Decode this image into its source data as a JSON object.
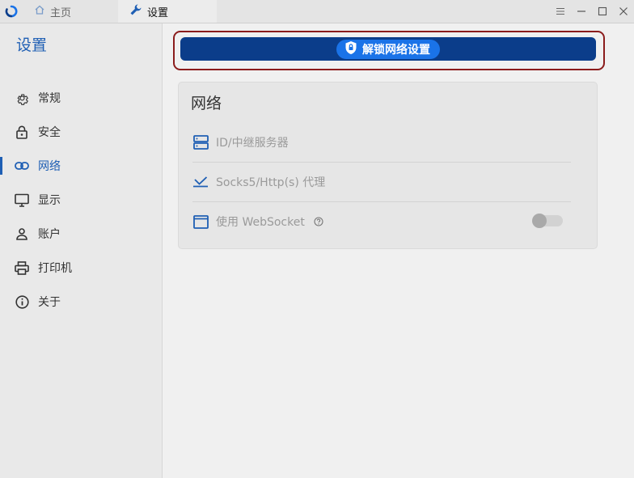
{
  "titlebar": {
    "tabs": [
      {
        "label": "主页",
        "icon": "home-icon"
      },
      {
        "label": "设置",
        "icon": "wrench-icon"
      }
    ],
    "controls": [
      "menu-icon",
      "minimize-icon",
      "maximize-icon",
      "close-icon"
    ]
  },
  "sidebar": {
    "title": "设置",
    "items": [
      {
        "label": "常规",
        "icon": "gear-icon"
      },
      {
        "label": "安全",
        "icon": "lock-icon"
      },
      {
        "label": "网络",
        "icon": "link-icon",
        "active": true
      },
      {
        "label": "显示",
        "icon": "monitor-icon"
      },
      {
        "label": "账户",
        "icon": "user-icon"
      },
      {
        "label": "打印机",
        "icon": "printer-icon"
      },
      {
        "label": "关于",
        "icon": "info-icon"
      }
    ]
  },
  "main": {
    "unlock_label": "解锁网络设置",
    "card": {
      "title": "网络",
      "rows": [
        {
          "label": "ID/中继服务器",
          "icon": "server-icon"
        },
        {
          "label": "Socks5/Http(s) 代理",
          "icon": "proxy-icon"
        },
        {
          "label": "使用 WebSocket",
          "icon": "window-icon",
          "toggle_on": false
        }
      ]
    }
  },
  "colors": {
    "accent": "#1f5fb4",
    "unlock_button": "#0b3d8a",
    "unlock_pill": "#1a73e8",
    "highlight_border": "#8b1c1c"
  }
}
